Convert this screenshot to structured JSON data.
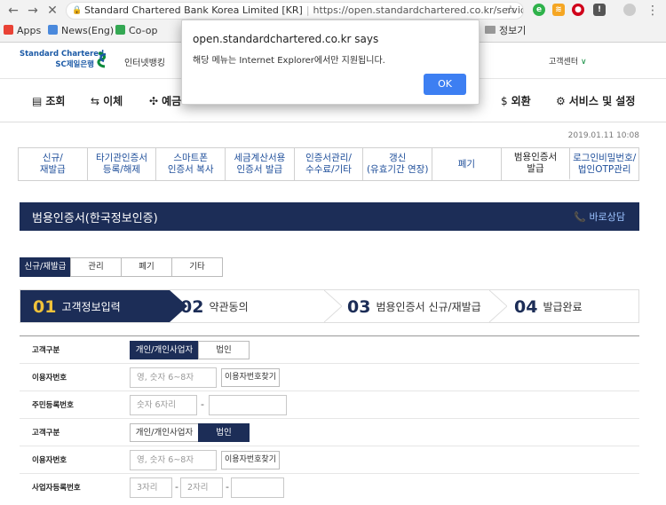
{
  "browser": {
    "tab_title": "Standard Chartered Bank Korea Limited [KR]",
    "url": "https://open.standardchartered.co.kr/service/ce...",
    "bookmarks": [
      {
        "label": "Apps",
        "color": "#e94235"
      },
      {
        "label": "News(Eng)",
        "color": "#4a89dc"
      },
      {
        "label": "Co-op",
        "color": "#34a853"
      },
      {
        "label": "정보기",
        "color": "#999999"
      }
    ]
  },
  "site": {
    "logo_line1": "Standard Chartered",
    "logo_line2": "SC제일은행",
    "internet_banking": "인터넷뱅킹",
    "customer_center": "고객센터",
    "nav": [
      {
        "icon": "▤",
        "label": "조회"
      },
      {
        "icon": "⇆",
        "label": "이체"
      },
      {
        "icon": "✣",
        "label": "예금"
      },
      {
        "icon": "$",
        "label": "외환"
      },
      {
        "icon": "⚙",
        "label": "서비스 및 설정"
      }
    ],
    "date": "2019.01.11 10:08"
  },
  "menu_tabs": [
    {
      "label": "신규/\n재발급"
    },
    {
      "label": "타기관인증서\n등록/해제"
    },
    {
      "label": "스마트폰\n인증서 복사"
    },
    {
      "label": "세금계산서용\n인증서 발급"
    },
    {
      "label": "인증서관리/\n수수료/기타"
    },
    {
      "label": "갱신\n(유효기간 연장)"
    },
    {
      "label": "폐기"
    },
    {
      "label": "범용인증서\n발급"
    },
    {
      "label": "로그인비밀번호/\n법인OTP관리"
    }
  ],
  "title": "범용인증서(한국정보인증)",
  "consult": "바로상담",
  "sub_tabs": [
    "신규/재발급",
    "관리",
    "폐기",
    "기타"
  ],
  "steps": [
    {
      "num": "01",
      "label": "고객정보입력"
    },
    {
      "num": "02",
      "label": "약관동의"
    },
    {
      "num": "03",
      "label": "범용인증서 신규/재발급"
    },
    {
      "num": "04",
      "label": "발급완료"
    }
  ],
  "form": {
    "customer_type_label": "고객구분",
    "type_individual": "개인/개인사업자",
    "type_corporate": "법인",
    "user_id_label": "이용자번호",
    "user_id_placeholder": "영, 숫자 6~8자",
    "find_user_id": "이용자번호찾기",
    "resident_label": "주민등록번호",
    "resident_placeholder": "숫자 6자리",
    "business_label": "사업자등록번호",
    "biz_ph1": "3자리",
    "biz_ph2": "2자리"
  },
  "dialog": {
    "title": "open.standardchartered.co.kr says",
    "message": "해당 메뉴는 Internet Explorer에서만 지원됩니다.",
    "ok": "OK"
  }
}
